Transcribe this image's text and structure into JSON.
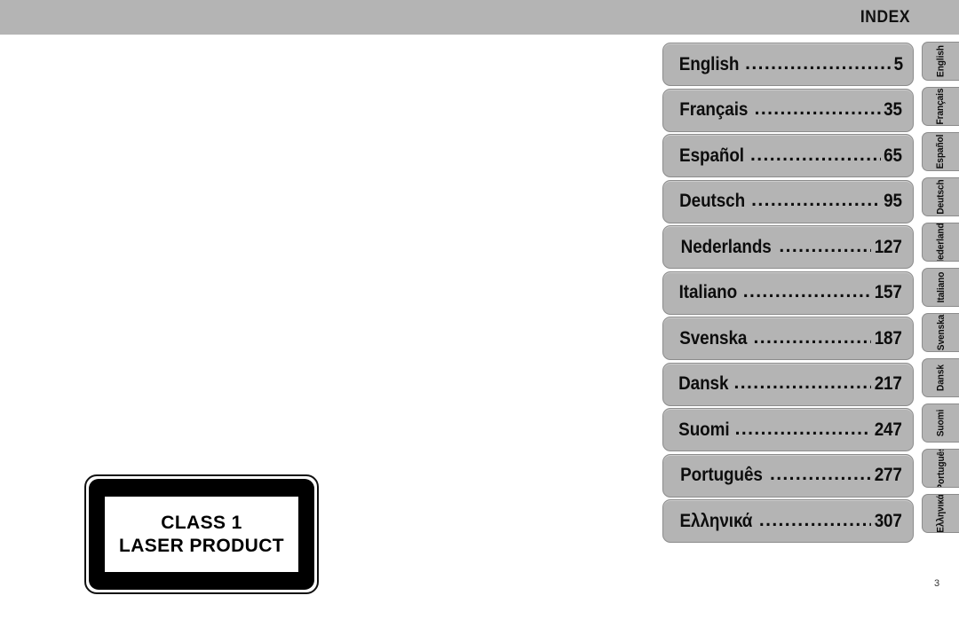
{
  "header": {
    "title": "INDEX",
    "bar_color": "#b4b4b4"
  },
  "page": {
    "number": "3",
    "background_color": "#ffffff",
    "text_color": "#0d0d0d",
    "row_fill_color": "#b4b4b4",
    "row_border_color": "#8c8c8c"
  },
  "index": {
    "leader": "......................................................",
    "rows": [
      {
        "language": "English",
        "page": "5",
        "tab": "English"
      },
      {
        "language": "Français",
        "page": "35",
        "tab": "Français"
      },
      {
        "language": "Español",
        "page": "65",
        "tab": "Español"
      },
      {
        "language": "Deutsch",
        "page": "95",
        "tab": "Deutsch"
      },
      {
        "language": "Nederlands",
        "page": "127",
        "tab": "Nederlands"
      },
      {
        "language": "Italiano",
        "page": "157",
        "tab": "Italiano"
      },
      {
        "language": "Svenska",
        "page": "187",
        "tab": "Svenska"
      },
      {
        "language": "Dansk",
        "page": "217",
        "tab": "Dansk"
      },
      {
        "language": "Suomi",
        "page": "247",
        "tab": "Suomi"
      },
      {
        "language": "Português",
        "page": "277",
        "tab": "Português"
      },
      {
        "language": "Ελληνικά",
        "page": "307",
        "tab": "Ελληνικά"
      }
    ]
  },
  "laser_label": {
    "line1": "CLASS 1",
    "line2": "LASER PRODUCT",
    "frame_color": "#000000",
    "inner_color": "#ffffff"
  }
}
